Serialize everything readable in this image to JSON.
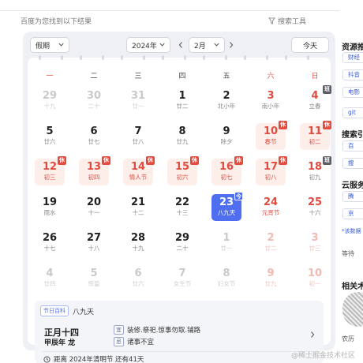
{
  "header": {
    "result_label": "百度为您找到以下结果",
    "search_tools_label": "搜索工具"
  },
  "controls": {
    "holiday_select": "假期",
    "year_select": "2024年",
    "month_select": "2月",
    "today_button": "今天"
  },
  "weekdays": [
    "一",
    "二",
    "三",
    "四",
    "五",
    "六",
    "日"
  ],
  "weeks": [
    [
      {
        "d": "29",
        "l": "十九",
        "out": true
      },
      {
        "d": "30",
        "l": "二十",
        "out": true
      },
      {
        "d": "31",
        "l": "廿一",
        "out": true
      },
      {
        "d": "1",
        "l": "廿二"
      },
      {
        "d": "2",
        "l": "北小年"
      },
      {
        "d": "3",
        "l": "南小年"
      },
      {
        "d": "4",
        "l": "立春",
        "tag": "班"
      }
    ],
    [
      {
        "d": "5",
        "l": "廿六"
      },
      {
        "d": "6",
        "l": "廿七"
      },
      {
        "d": "7",
        "l": "廿八"
      },
      {
        "d": "8",
        "l": "廿九"
      },
      {
        "d": "9",
        "l": "除夕"
      },
      {
        "d": "10",
        "l": "春节",
        "tag": "休",
        "hol": true
      },
      {
        "d": "11",
        "l": "初二",
        "tag": "休",
        "hol": true
      }
    ],
    [
      {
        "d": "12",
        "l": "初三",
        "tag": "休",
        "hol": true
      },
      {
        "d": "13",
        "l": "初四",
        "tag": "休",
        "hol": true
      },
      {
        "d": "14",
        "l": "情人节",
        "tag": "休",
        "hol": true
      },
      {
        "d": "15",
        "l": "初六",
        "tag": "休",
        "hol": true
      },
      {
        "d": "16",
        "l": "初七",
        "tag": "休",
        "hol": true
      },
      {
        "d": "17",
        "l": "初八",
        "tag": "休",
        "hol": true
      },
      {
        "d": "18",
        "l": "初九",
        "tag": "班"
      }
    ],
    [
      {
        "d": "19",
        "l": "雨水"
      },
      {
        "d": "20",
        "l": "十一"
      },
      {
        "d": "21",
        "l": "十二"
      },
      {
        "d": "22",
        "l": "十三"
      },
      {
        "d": "23",
        "l": "八九天",
        "tag": "今",
        "sel": true
      },
      {
        "d": "24",
        "l": "元宵节",
        "fest": true
      },
      {
        "d": "25",
        "l": "十六"
      }
    ],
    [
      {
        "d": "26",
        "l": "十七"
      },
      {
        "d": "27",
        "l": "十八"
      },
      {
        "d": "28",
        "l": "十九"
      },
      {
        "d": "29",
        "l": "二十"
      },
      {
        "d": "1",
        "l": "廿一",
        "out": true
      },
      {
        "d": "2",
        "l": "廿二",
        "out": true
      },
      {
        "d": "3",
        "l": "廿三",
        "out": true
      }
    ],
    [
      {
        "d": "4",
        "l": "廿四",
        "out": true
      },
      {
        "d": "5",
        "l": "惊蛰",
        "out": true
      },
      {
        "d": "6",
        "l": "廿六",
        "out": true
      },
      {
        "d": "7",
        "l": "女生节",
        "out": true
      },
      {
        "d": "8",
        "l": "妇女节",
        "out": true
      },
      {
        "d": "9",
        "l": "廿九",
        "out": true
      },
      {
        "d": "10",
        "l": "初一",
        "out": true
      }
    ]
  ],
  "info": {
    "badge": "节日百科",
    "jieqi": "八九天",
    "lunar_date": "正月十四",
    "lunar_year": "甲辰年 龙",
    "yi_key": "宜",
    "yi_text": "装修.祭祀.惊事勿取.铺路",
    "ji_key": "忌",
    "ji_text": "诸事不宜",
    "countdown": "距离 2024年清明节 还有41天"
  },
  "sidebar": {
    "heading1": "资源推",
    "btn1": "财经",
    "btn2": "抖音",
    "btn3": "电影",
    "btn4": "git",
    "heading2": "搜索引",
    "btn5": "百",
    "btn6": "搜",
    "heading3": "云服务",
    "btn7": "腾",
    "btn8": "京",
    "note": "*该数据",
    "more": "等待",
    "heading4": "相关术",
    "bottom_label": "农历"
  },
  "watermark": "@稀土掘金技术社区",
  "colors": {
    "red": "#e04b3f",
    "holiday_bg": "#fdeeea",
    "selected": "#4f6ff0",
    "card_bg": "#eef0f6"
  }
}
